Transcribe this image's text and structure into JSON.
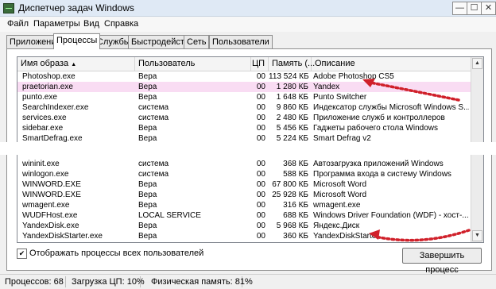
{
  "window": {
    "title": "Диспетчер задач Windows"
  },
  "title_controls": {
    "minimize": "—",
    "maximize": "☐",
    "close": "✕"
  },
  "menu": [
    "Файл",
    "Параметры",
    "Вид",
    "Справка"
  ],
  "tabs": [
    "Приложения",
    "Процессы",
    "Службы",
    "Быстродействие",
    "Сеть",
    "Пользователи"
  ],
  "active_tab": "Процессы",
  "table": {
    "columns": [
      "Имя образа",
      "Пользователь",
      "ЦП",
      "Память (...",
      "Описание"
    ],
    "sort_indicator": "▲",
    "rows_top": [
      [
        "Photoshop.exe",
        "Вера",
        "00",
        "113 524 КБ",
        "Adobe Photoshop CS5"
      ],
      [
        "praetorian.exe",
        "Вера",
        "00",
        "1 280 КБ",
        "Yandex"
      ],
      [
        "punto.exe",
        "Вера",
        "00",
        "1 648 КБ",
        "Punto Switcher"
      ],
      [
        "SearchIndexer.exe",
        "система",
        "00",
        "9 860 КБ",
        "Индексатор службы Microsoft Windows S..."
      ],
      [
        "services.exe",
        "система",
        "00",
        "2 480 КБ",
        "Приложение служб и контроллеров"
      ],
      [
        "sidebar.exe",
        "Вера",
        "00",
        "5 456 КБ",
        "Гаджеты рабочего стола Windows"
      ],
      [
        "SmartDefrag.exe",
        "Вера",
        "00",
        "5 224 КБ",
        "Smart Defrag v2"
      ]
    ],
    "rows_bottom": [
      [
        "wininit.exe",
        "система",
        "00",
        "368 КБ",
        "Автозагрузка приложений Windows"
      ],
      [
        "winlogon.exe",
        "система",
        "00",
        "588 КБ",
        "Программа входа в систему Windows"
      ],
      [
        "WINWORD.EXE",
        "Вера",
        "00",
        "67 800 КБ",
        "Microsoft Word"
      ],
      [
        "WINWORD.EXE",
        "Вера",
        "00",
        "25 928 КБ",
        "Microsoft Word"
      ],
      [
        "wmagent.exe",
        "Вера",
        "00",
        "316 КБ",
        "wmagent.exe"
      ],
      [
        "WUDFHost.exe",
        "LOCAL SERVICE",
        "00",
        "688 КБ",
        "Windows Driver Foundation (WDF) - хост-..."
      ],
      [
        "YandexDisk.exe",
        "Вера",
        "00",
        "5 968 КБ",
        "Яндекс.Диск"
      ],
      [
        "YandexDiskStarter.exe",
        "Вера",
        "00",
        "360 КБ",
        "YandexDiskStarter"
      ]
    ]
  },
  "show_all_users": {
    "label": "Отображать процессы всех пользователей",
    "checked": "✔"
  },
  "end_process_button": "Завершить процесс",
  "status": {
    "processes": "Процессов: 68",
    "cpu": "Загрузка ЦП: 10%",
    "memory": "Физическая память: 81%"
  },
  "colors": {
    "selected_row": "#f9dcf3",
    "arrow": "#d0202a"
  }
}
